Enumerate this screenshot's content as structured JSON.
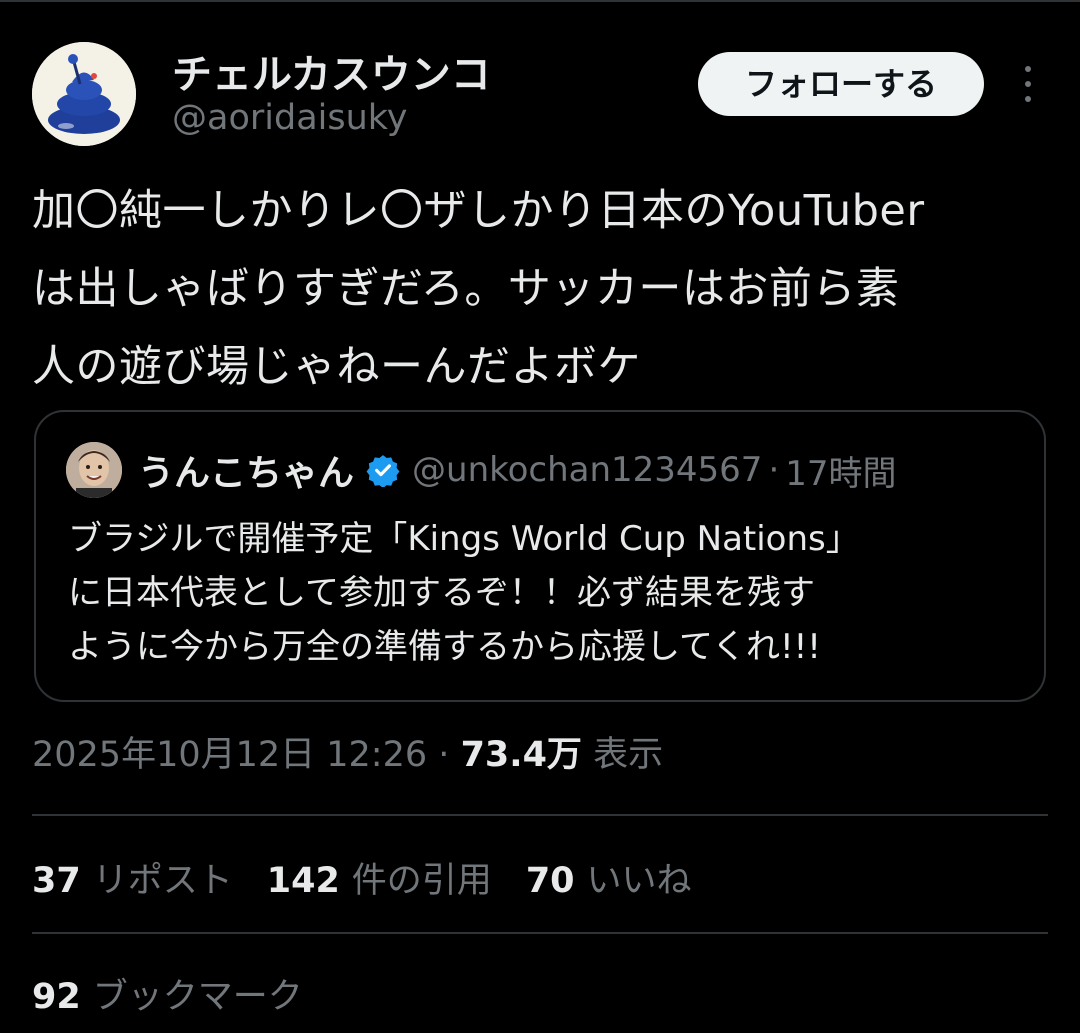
{
  "author": {
    "display_name": "チェルカスウンコ",
    "handle": "@aoridaisuky"
  },
  "follow_button": {
    "label": "フォローする"
  },
  "tweet": {
    "lines": [
      "加〇純一しかりレ〇ザしかり日本のYouTuber",
      "は出しゃばりすぎだろ。サッカーはお前ら素",
      "人の遊び場じゃねーんだよボケ"
    ]
  },
  "quote": {
    "display_name": "うんこちゃん",
    "handle": "@unkochan1234567",
    "separator": "·",
    "time": "17時間",
    "lines": [
      "ブラジルで開催予定「Kings World Cup Nations」",
      "に日本代表として参加するぞ！！必ず結果を残す",
      "ように今から万全の準備するから応援してくれ!!!"
    ]
  },
  "meta": {
    "timestamp": "2025年10月12日 12:26",
    "separator": "·",
    "views_count": "73.4万",
    "views_label": "表示"
  },
  "stats": {
    "reposts": {
      "count": "37",
      "label": "リポスト"
    },
    "quotes": {
      "count": "142",
      "label": "件の引用"
    },
    "likes": {
      "count": "70",
      "label": "いいね"
    },
    "bookmarks": {
      "count": "92",
      "label": "ブックマーク"
    }
  },
  "colors": {
    "background": "#000000",
    "text_primary": "#e7e9ea",
    "text_secondary": "#71767b",
    "border": "#2f3336",
    "verified": "#1d9bf0"
  }
}
